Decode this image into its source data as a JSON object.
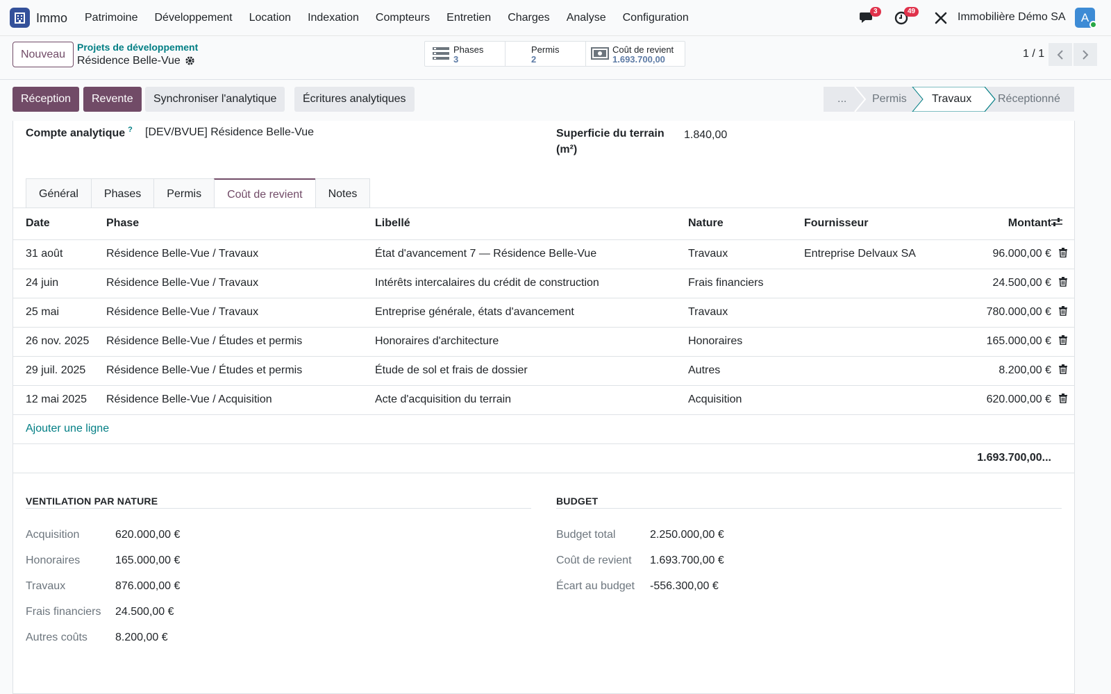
{
  "nav": {
    "app_name": "Immo",
    "menu": [
      "Patrimoine",
      "Développement",
      "Location",
      "Indexation",
      "Compteurs",
      "Entretien",
      "Charges",
      "Analyse",
      "Configuration"
    ],
    "messages_badge": "3",
    "activities_badge": "49",
    "company": "Immobilière Démo SA",
    "avatar_letter": "A"
  },
  "control": {
    "new_button": "Nouveau",
    "breadcrumb": "Projets de développement",
    "record_name": "Résidence Belle-Vue",
    "smart_buttons": [
      {
        "label": "Phases",
        "value": "3",
        "icon": "list-icon"
      },
      {
        "label": "Permis",
        "value": "2",
        "icon": "none"
      },
      {
        "label": "Coût de revient",
        "value": "1.693.700,00",
        "icon": "money-icon"
      }
    ],
    "pager": "1 / 1"
  },
  "actions": {
    "reception": "Réception",
    "revente": "Revente",
    "sync": "Synchroniser l'analytique",
    "ecritures": "Écritures analytiques"
  },
  "stages": {
    "more": "...",
    "items": [
      "Permis",
      "Travaux",
      "Réceptionné"
    ],
    "current": "Travaux"
  },
  "fields": {
    "analytic_label": "Compte analytique",
    "analytic_help": "?",
    "analytic_value": "[DEV/BVUE] Résidence Belle-Vue",
    "area_label_1": "Superficie du terrain",
    "area_label_2": "(m²)",
    "area_value": "1.840,00"
  },
  "tabs": [
    "Général",
    "Phases",
    "Permis",
    "Coût de revient",
    "Notes"
  ],
  "active_tab": "Coût de revient",
  "table": {
    "headers": {
      "date": "Date",
      "phase": "Phase",
      "libelle": "Libellé",
      "nature": "Nature",
      "fournisseur": "Fournisseur",
      "montant": "Montant"
    },
    "rows": [
      {
        "date": "31 août",
        "phase": "Résidence Belle-Vue / Travaux",
        "libelle": "État d'avancement 7 — Résidence Belle-Vue",
        "nature": "Travaux",
        "fournisseur": "Entreprise Delvaux SA",
        "montant": "96.000,00 €"
      },
      {
        "date": "24 juin",
        "phase": "Résidence Belle-Vue / Travaux",
        "libelle": "Intérêts intercalaires du crédit de construction",
        "nature": "Frais financiers",
        "fournisseur": "",
        "montant": "24.500,00 €"
      },
      {
        "date": "25 mai",
        "phase": "Résidence Belle-Vue / Travaux",
        "libelle": "Entreprise générale, états d'avancement",
        "nature": "Travaux",
        "fournisseur": "",
        "montant": "780.000,00 €"
      },
      {
        "date": "26 nov. 2025",
        "phase": "Résidence Belle-Vue / Études et permis",
        "libelle": "Honoraires d'architecture",
        "nature": "Honoraires",
        "fournisseur": "",
        "montant": "165.000,00 €"
      },
      {
        "date": "29 juil. 2025",
        "phase": "Résidence Belle-Vue / Études et permis",
        "libelle": "Étude de sol et frais de dossier",
        "nature": "Autres",
        "fournisseur": "",
        "montant": "8.200,00 €"
      },
      {
        "date": "12 mai 2025",
        "phase": "Résidence Belle-Vue / Acquisition",
        "libelle": "Acte d'acquisition du terrain",
        "nature": "Acquisition",
        "fournisseur": "",
        "montant": "620.000,00 €"
      }
    ],
    "add_line": "Ajouter une ligne",
    "total": "1.693.700,00..."
  },
  "ventilation": {
    "title": "VENTILATION PAR NATURE",
    "items": [
      {
        "label": "Acquisition",
        "value": "620.000,00 €"
      },
      {
        "label": "Honoraires",
        "value": "165.000,00 €"
      },
      {
        "label": "Travaux",
        "value": "876.000,00 €"
      },
      {
        "label": "Frais financiers",
        "value": "24.500,00 €"
      },
      {
        "label": "Autres coûts",
        "value": "8.200,00 €"
      }
    ]
  },
  "budget": {
    "title": "BUDGET",
    "items": [
      {
        "label": "Budget total",
        "value": "2.250.000,00 €"
      },
      {
        "label": "Coût de revient",
        "value": "1.693.700,00 €"
      },
      {
        "label": "Écart au budget",
        "value": "-556.300,00 €"
      }
    ]
  },
  "colors": {
    "primary": "#714b67",
    "link": "#017e84",
    "badge": "#e0324b",
    "app": "#34519a"
  }
}
